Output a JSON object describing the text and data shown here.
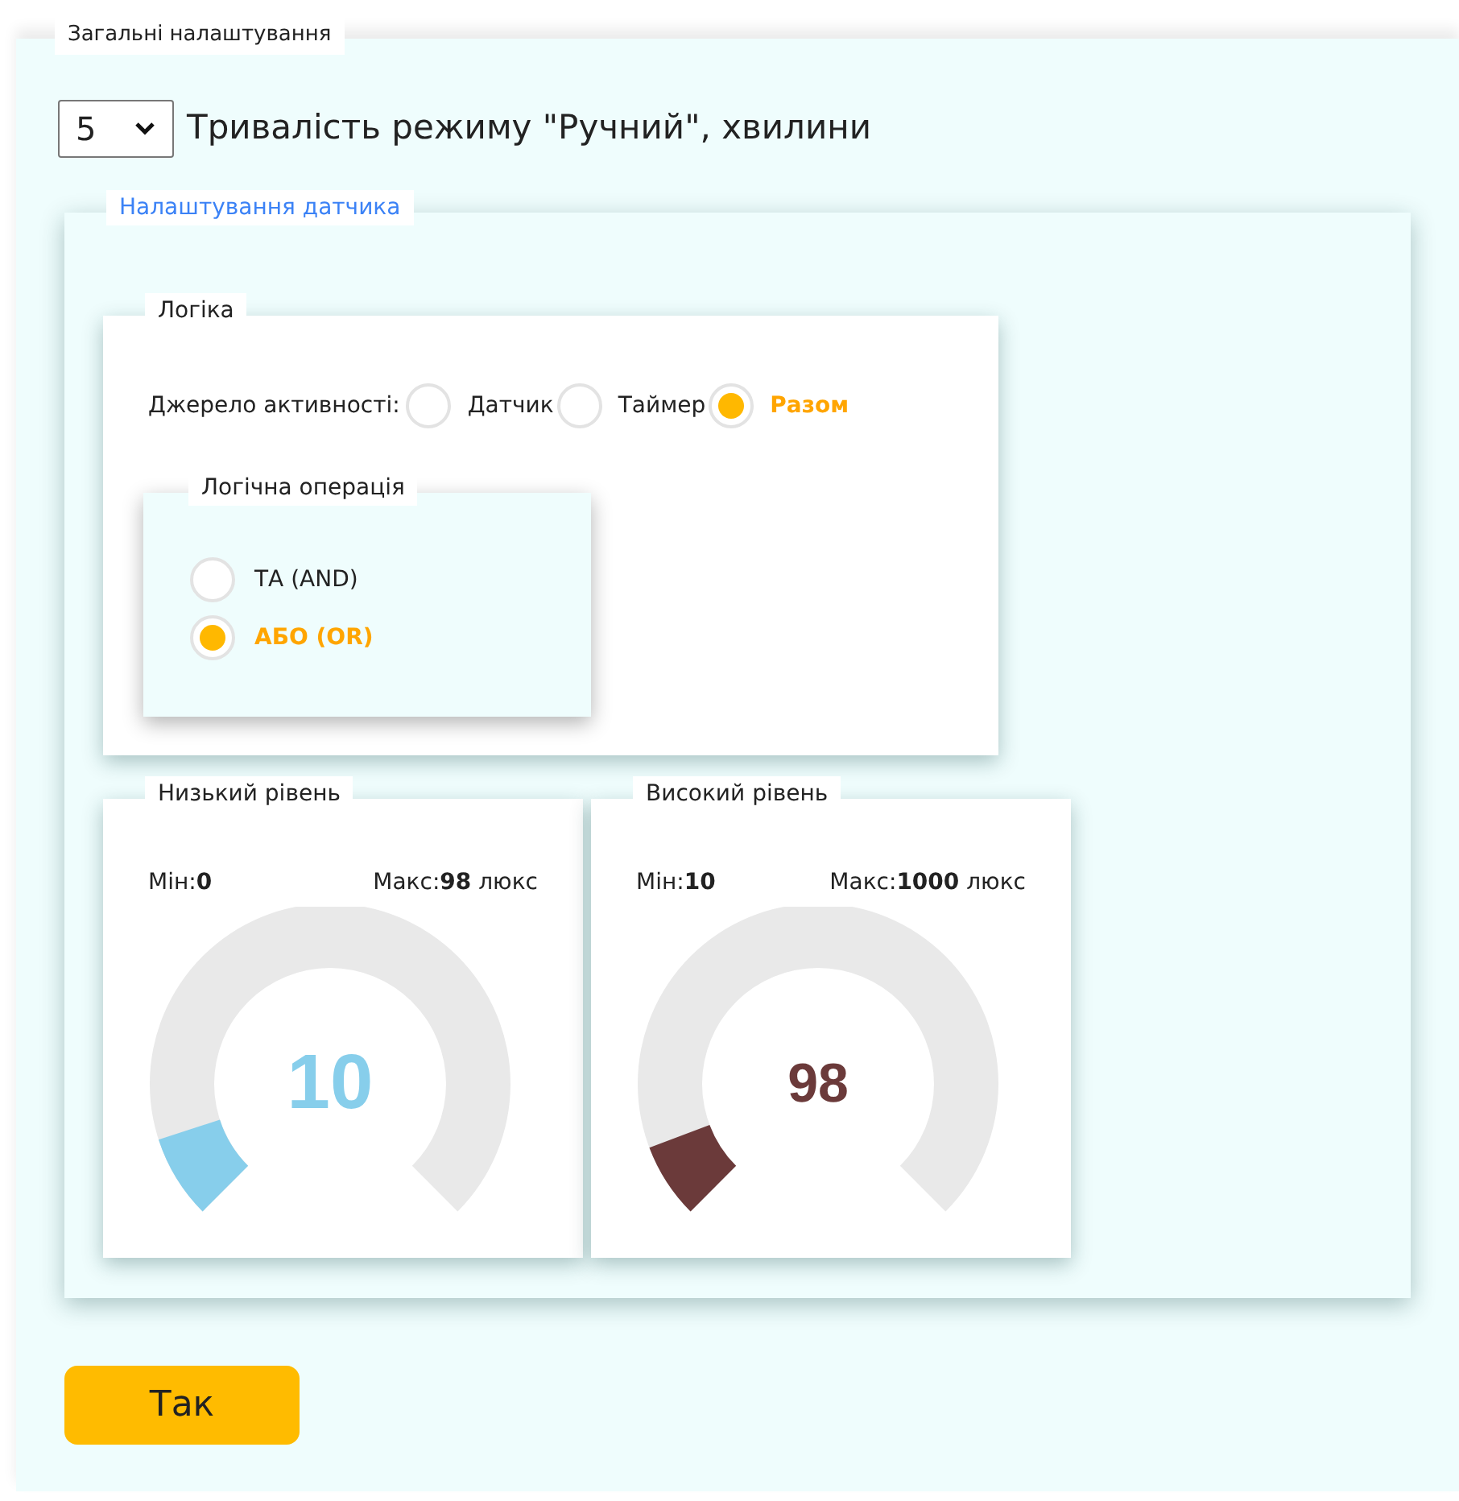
{
  "general": {
    "legend": "Загальні налаштування",
    "duration_select": {
      "value": "5"
    },
    "duration_label": "Тривалість режиму \"Ручний\", хвилини"
  },
  "sensor": {
    "legend": "Налаштування датчика",
    "logic": {
      "legend": "Логіка",
      "source_label": "Джерело активності:",
      "sources": [
        {
          "label": "Датчик",
          "selected": false
        },
        {
          "label": "Таймер",
          "selected": false
        },
        {
          "label": "Разом",
          "selected": true
        }
      ],
      "operation": {
        "legend": "Логічна операція",
        "options": [
          {
            "label": "ТА (AND)",
            "selected": false
          },
          {
            "label": "АБО (OR)",
            "selected": true
          }
        ]
      }
    },
    "levels": [
      {
        "legend": "Низький рівень",
        "min": "Мін:**0**",
        "max": "Макс:**98** люкс",
        "value": "10",
        "level": 0.1,
        "color": "#87ceeb"
      },
      {
        "legend": "Високий рівень",
        "min": "Мін:**10**",
        "max": "Макс:**1000** люкс",
        "value": "98",
        "level": 0.09,
        "color": "#6b3a3a"
      }
    ]
  },
  "ok_button": "Так"
}
